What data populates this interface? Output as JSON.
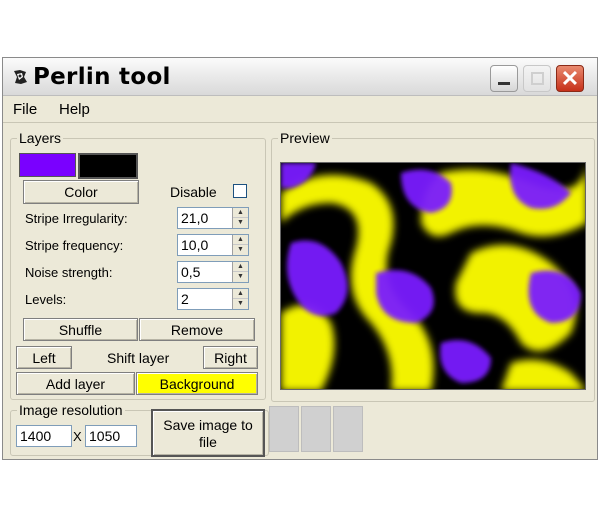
{
  "window": {
    "title": "Perlin tool",
    "close_glyph": "✕"
  },
  "menu": {
    "file": "File",
    "help": "Help"
  },
  "layers": {
    "legend": "Layers",
    "colors": {
      "swatch_1": "#7a00ff",
      "swatch_2": "#000000"
    },
    "color_button": "Color",
    "disable_label": "Disable",
    "disable_checked": false,
    "params": [
      {
        "label": "Stripe Irregularity:",
        "value": "21,0"
      },
      {
        "label": "Stripe frequency:",
        "value": "10,0"
      },
      {
        "label": "Noise strength:",
        "value": "0,5"
      },
      {
        "label": "Levels:",
        "value": "2"
      }
    ],
    "shuffle_button": "Shuffle",
    "remove_button": "Remove",
    "left_button": "Left",
    "shift_layer_label": "Shift layer",
    "right_button": "Right",
    "add_layer_button": "Add layer",
    "background_button": "Background",
    "background_color": "#ffff00"
  },
  "preview": {
    "legend": "Preview",
    "colors": {
      "yellow": "#f2f200",
      "purple": "#7a1cff",
      "black": "#000000"
    }
  },
  "resolution": {
    "legend": "Image resolution",
    "width": "1400",
    "separator": "X",
    "height": "1050",
    "save_button_line1": "Save image to",
    "save_button_line2": "file"
  }
}
